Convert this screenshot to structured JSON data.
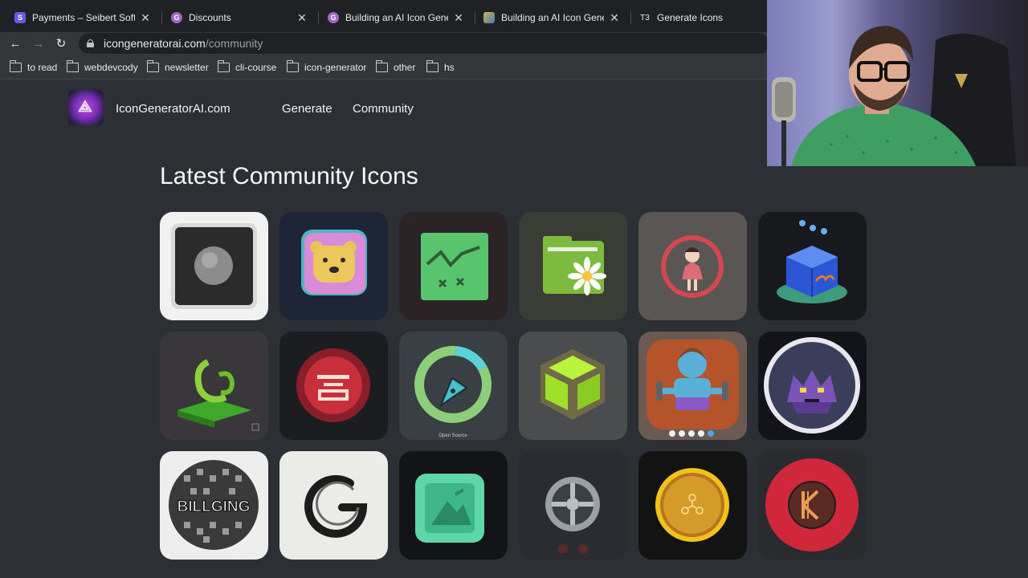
{
  "browser": {
    "tabs": [
      {
        "label": "Payments – Seibert Softwa",
        "favicon": "S",
        "favicon_color": "#6b57e8"
      },
      {
        "label": "Discounts",
        "favicon": "G",
        "favicon_color": "#a566c9"
      },
      {
        "label": "Building an AI Icon Generat",
        "favicon": "G",
        "favicon_color": "#a566c9"
      },
      {
        "label": "Building an AI Icon Generat",
        "favicon": "",
        "favicon_color": "#d4b24a"
      },
      {
        "label": "Generate Icons",
        "favicon": "T3",
        "favicon_color": "#1f2124"
      }
    ],
    "url_domain": "icongeneratorai.com",
    "url_path": "/community",
    "bookmarks": [
      "to read",
      "webdevcody",
      "newsletter",
      "cli-course",
      "icon-generator",
      "other",
      "hs"
    ]
  },
  "site": {
    "brand": "IconGeneratorAI.com",
    "nav": [
      "Generate",
      "Community"
    ],
    "heading": "Latest Community Icons"
  },
  "icons": [
    {
      "name": "pixel-moon-icon",
      "bg": "#f1f1f1"
    },
    {
      "name": "bear-face-icon",
      "bg": "#1e2536"
    },
    {
      "name": "green-chart-icon",
      "bg": "#2c2326"
    },
    {
      "name": "folder-daisy-icon",
      "bg": "#3a3d36"
    },
    {
      "name": "girl-circle-icon",
      "bg": "#5a5653"
    },
    {
      "name": "blue-cube-icon",
      "bg": "#17191c"
    },
    {
      "name": "green-swirl-icon",
      "bg": "#3a373b"
    },
    {
      "name": "red-pixel-badge-icon",
      "bg": "#1b1d21"
    },
    {
      "name": "pen-nib-ring-icon",
      "bg": "#3a3f44",
      "caption": "Open Source"
    },
    {
      "name": "lime-cube-icon",
      "bg": "#4a4c4e"
    },
    {
      "name": "blue-strongman-icon",
      "bg": "#6a5a52"
    },
    {
      "name": "purple-pixel-monster-icon",
      "bg": "#121419"
    },
    {
      "name": "billging-pixel-icon",
      "bg": "#eeeeee",
      "caption": "BILLGING"
    },
    {
      "name": "swoosh-g-icon",
      "bg": "#ebebe8"
    },
    {
      "name": "teal-square-icon",
      "bg": "#121417"
    },
    {
      "name": "silver-wheel-icon",
      "bg": "#2a2c31"
    },
    {
      "name": "gold-coin-icon",
      "bg": "#131314"
    },
    {
      "name": "red-k-badge-icon",
      "bg": "#2a2b2e"
    }
  ]
}
